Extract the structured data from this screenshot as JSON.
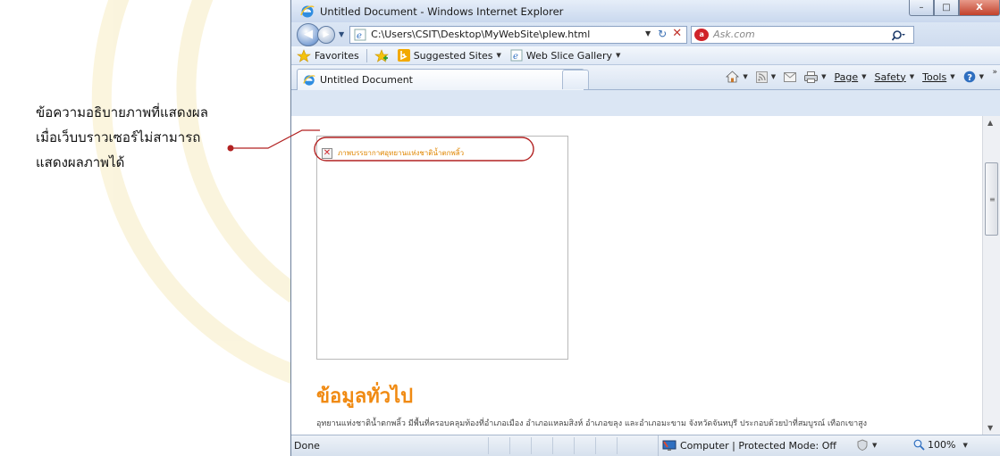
{
  "annotation": {
    "lines": [
      "ข้อความอธิบายภาพที่แสดงผล",
      "เมื่อเว็บบราวเซอร์ไม่สามารถ",
      "แสดงผลภาพได้"
    ],
    "accent_color": "#b22222"
  },
  "window": {
    "title": "Untitled Document - Windows Internet Explorer",
    "controls": {
      "minimize": "–",
      "maximize": "□",
      "close": "X"
    }
  },
  "address_bar": {
    "url": "C:\\Users\\CSIT\\Desktop\\MyWebSite\\plew.html",
    "search_placeholder": "Ask.com"
  },
  "favorites_bar": {
    "favorites_label": "Favorites",
    "items": [
      "Suggested Sites",
      "Web Slice Gallery"
    ]
  },
  "tab": {
    "label": "Untitled Document"
  },
  "command_bar": {
    "page": "Page",
    "safety": "Safety",
    "tools": "Tools"
  },
  "page": {
    "image_alt": "ภาพบรรยากาศอุทยานแห่งชาติน้ำตกพลิ้ว",
    "heading": "ข้อมูลทั่วไป",
    "paragraph": "อุทยานแห่งชาติน้ำตกพลิ้ว มีพื้นที่ครอบคลุมท้องที่อำเภอเมือง อำเภอแหลมสิงห์ อำเภอขลุง และอำเภอมะขาม จังหวัดจันทบุรี ประกอบด้วยป่าที่สมบูรณ์ เทือกเขาสูง",
    "heading_color": "#f08a12",
    "alt_color": "#e08600"
  },
  "status_bar": {
    "status": "Done",
    "zone": "Computer | Protected Mode: Off",
    "zoom": "100%"
  }
}
